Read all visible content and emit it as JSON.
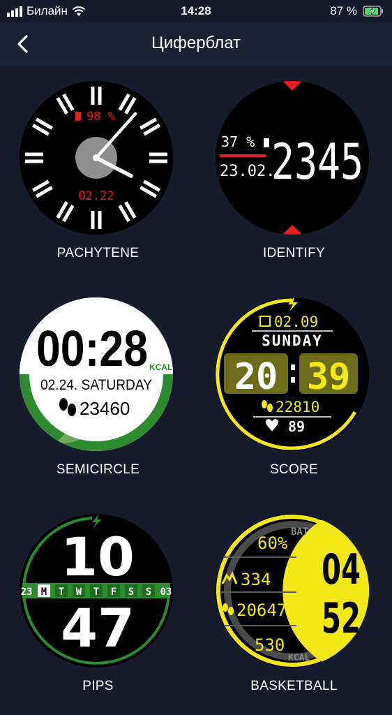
{
  "status": {
    "carrier": "Билайн",
    "time": "14:28",
    "battery": "87 %"
  },
  "nav": {
    "title": "Циферблат"
  },
  "faces": [
    {
      "name": "PACHYTENE",
      "battery": "98 %",
      "date": "02.22"
    },
    {
      "name": "IDENTIFY",
      "battery": "37 %",
      "date": "23.02.",
      "time": "2345"
    },
    {
      "name": "SEMICIRCLE",
      "time": "00:28",
      "kcal": "KCAL",
      "date": "02.24. SATURDAY",
      "steps": "23460"
    },
    {
      "name": "SCORE",
      "date": "02.09",
      "day": "SUNDAY",
      "hours": "20",
      "minutes": "39",
      "steps": "22810",
      "heart": "89"
    },
    {
      "name": "PIPS",
      "hours": "10",
      "minutes": "47",
      "weekdays": [
        "23",
        "M",
        "T",
        "W",
        "T",
        "F",
        "S",
        "S",
        "03"
      ]
    },
    {
      "name": "BASKETBALL",
      "battery": "60%",
      "bat": "BAT",
      "floors": "334",
      "steps": "20647",
      "kcal_value": "530",
      "kcal": "KCAL",
      "hours": "04",
      "minutes": "52"
    }
  ],
  "colors": {
    "background": "#161c2c",
    "red": "#e01f1f",
    "yellow": "#f2e818",
    "green": "#2e8a2e"
  }
}
